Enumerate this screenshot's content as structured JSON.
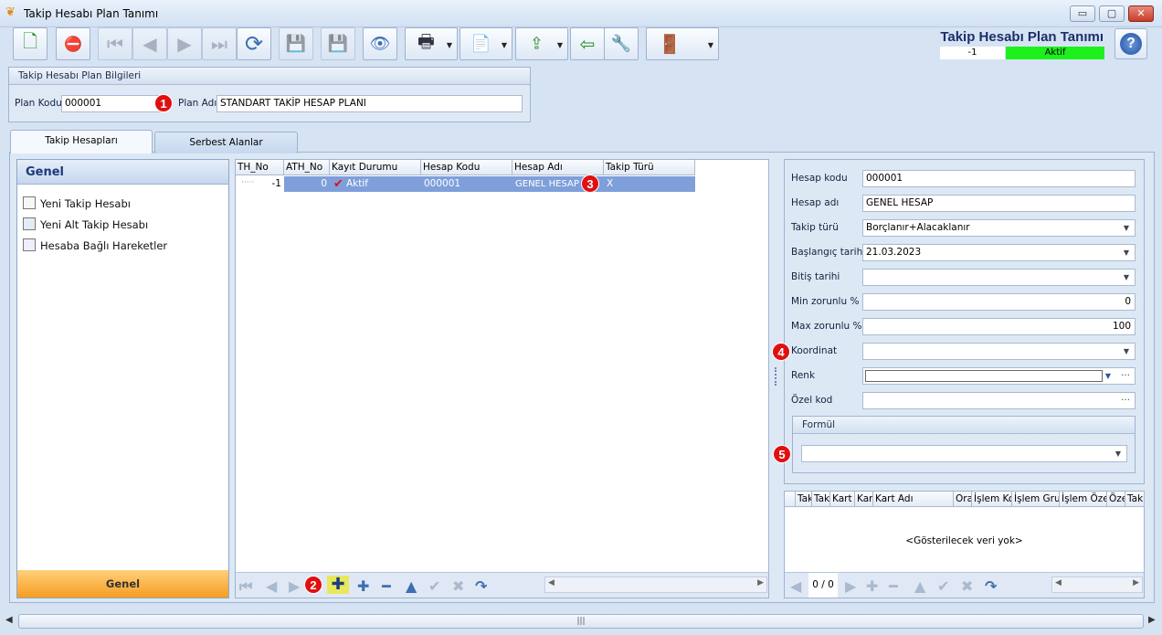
{
  "window": {
    "title": "Takip Hesabı Plan Tanımı",
    "controls": [
      "▭",
      "▢",
      "✕"
    ]
  },
  "toolbar": {
    "header_title": "Takip Hesabı Plan Tanımı",
    "status_id": "-1",
    "status_text": "Aktif",
    "status_color": "#1df01d",
    "help_label": "?",
    "buttons": [
      {
        "name": "new-icon",
        "glyph": "🗋"
      },
      {
        "name": "delete-icon",
        "glyph": "⛔"
      },
      {
        "name": "first-icon",
        "glyph": "⏮"
      },
      {
        "name": "prev-icon",
        "glyph": "◀"
      },
      {
        "name": "next-icon",
        "glyph": "▶"
      },
      {
        "name": "last-icon",
        "glyph": "⏭"
      },
      {
        "name": "refresh-icon",
        "glyph": "⟳"
      },
      {
        "name": "save-icon",
        "glyph": "💾"
      },
      {
        "name": "save-close-icon",
        "glyph": "💾"
      },
      {
        "name": "preview-icon",
        "glyph": "👁"
      },
      {
        "name": "print-icon",
        "glyph": "🖶"
      },
      {
        "name": "pdf-icon",
        "glyph": "📄"
      },
      {
        "name": "export-icon",
        "glyph": "⇪"
      },
      {
        "name": "import-icon",
        "glyph": "⇦"
      },
      {
        "name": "tools-icon",
        "glyph": "🔧"
      },
      {
        "name": "exit-icon",
        "glyph": "🚪"
      }
    ]
  },
  "plan_info": {
    "group_title": "Takip Hesabı Plan Bilgileri",
    "code_label": "Plan Kodu",
    "code_value": "000001",
    "name_label": "Plan Adı",
    "name_value": "STANDART TAKİP HESAP PLANI"
  },
  "badges": [
    "1",
    "2",
    "3",
    "4",
    "5"
  ],
  "tabs": [
    {
      "label": "Takip Hesapları"
    },
    {
      "label": "Serbest Alanlar"
    }
  ],
  "nav": {
    "header": "Genel",
    "items": [
      {
        "label": "Yeni Takip Hesabı"
      },
      {
        "label": "Yeni Alt Takip Hesabı"
      },
      {
        "label": "Hesaba Bağlı Hareketler"
      }
    ],
    "footer": "Genel"
  },
  "grid": {
    "columns": [
      "TH_No",
      "ATH_No",
      "Kayıt Durumu",
      "Hesap Kodu",
      "Hesap Adı",
      "Takip Türü"
    ],
    "row": {
      "th_no": "-1",
      "ath_no": "0",
      "status": "Aktif",
      "code": "000001",
      "name": "GENEL HESAP",
      "type": "X"
    },
    "selected_color": "#7f9fdb"
  },
  "detail": {
    "fields": [
      {
        "label": "Hesap kodu",
        "value": "000001"
      },
      {
        "label": "Hesap adı",
        "value": "GENEL HESAP"
      },
      {
        "label": "Takip türü",
        "value": "Borçlanır+Alacaklanır"
      },
      {
        "label": "Başlangıç tarihi",
        "value": "21.03.2023"
      },
      {
        "label": "Bitiş tarihi",
        "value": ""
      },
      {
        "label": "Min zorunlu %",
        "value": "0"
      },
      {
        "label": "Max zorunlu %",
        "value": "100"
      },
      {
        "label": "Koordinat",
        "value": ""
      },
      {
        "label": "Renk",
        "value": ""
      },
      {
        "label": "Özel kod",
        "value": ""
      }
    ],
    "formula_title": "Formül",
    "formula_value": ""
  },
  "mini_grid": {
    "columns": [
      "Tak",
      "Tak",
      "Kart",
      "Kar",
      "Kart Adı",
      "Ora",
      "İşlem Ko",
      "İşlem Gru",
      "İşlem Öze",
      "Öze",
      "Tak"
    ],
    "empty_text": "<Gösterilecek veri yok>",
    "page_info": "0 / 0"
  }
}
